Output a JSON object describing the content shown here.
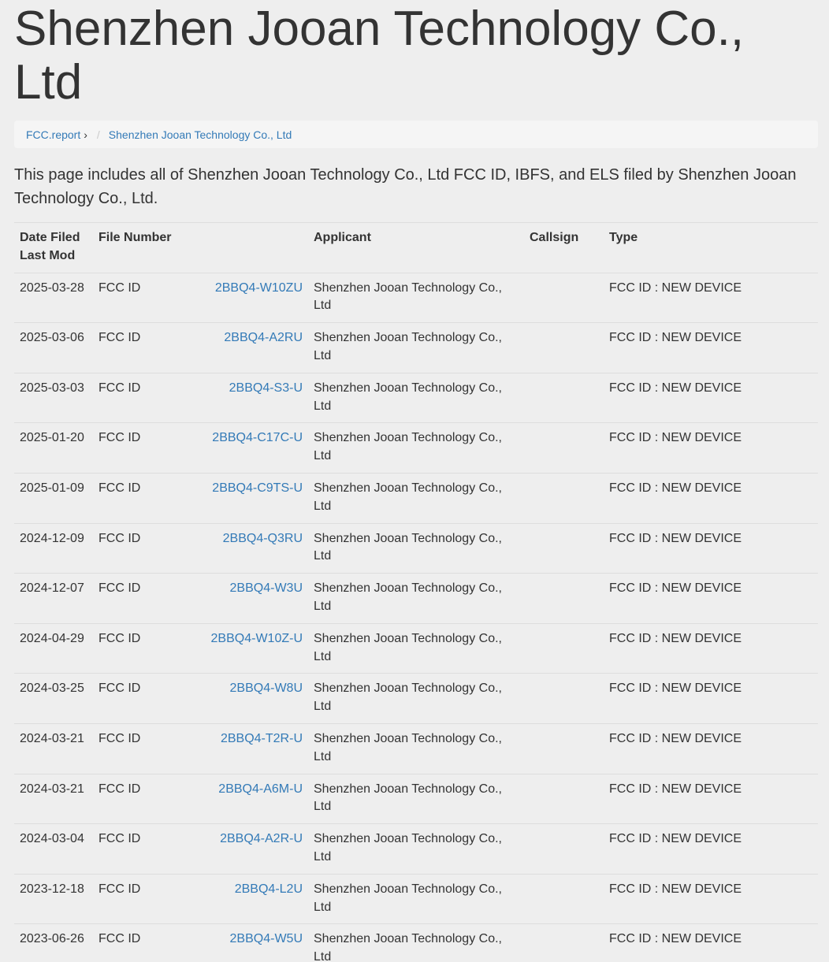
{
  "page_title": "Shenzhen Jooan Technology Co., Ltd",
  "breadcrumb": {
    "home": "FCC.report",
    "home_arrow": "›",
    "separator": "/",
    "current": "Shenzhen Jooan Technology Co., Ltd"
  },
  "intro": "This page includes all of Shenzhen Jooan Technology Co., Ltd FCC ID, IBFS, and ELS filed by Shenzhen Jooan Technology Co., Ltd.",
  "table": {
    "headers": {
      "date_line1": "Date Filed",
      "date_line2": "Last Mod",
      "file_number": "File Number",
      "applicant": "Applicant",
      "callsign": "Callsign",
      "type": "Type"
    },
    "rows": [
      {
        "date": "2025-03-28",
        "kind": "FCC ID",
        "file": "2BBQ4-W10ZU",
        "applicant": "Shenzhen Jooan Technology Co., Ltd",
        "callsign": "",
        "type": "FCC ID : NEW DEVICE"
      },
      {
        "date": "2025-03-06",
        "kind": "FCC ID",
        "file": "2BBQ4-A2RU",
        "applicant": "Shenzhen Jooan Technology Co., Ltd",
        "callsign": "",
        "type": "FCC ID : NEW DEVICE"
      },
      {
        "date": "2025-03-03",
        "kind": "FCC ID",
        "file": "2BBQ4-S3-U",
        "applicant": "Shenzhen Jooan Technology Co., Ltd",
        "callsign": "",
        "type": "FCC ID : NEW DEVICE"
      },
      {
        "date": "2025-01-20",
        "kind": "FCC ID",
        "file": "2BBQ4-C17C-U",
        "applicant": "Shenzhen Jooan Technology Co., Ltd",
        "callsign": "",
        "type": "FCC ID : NEW DEVICE"
      },
      {
        "date": "2025-01-09",
        "kind": "FCC ID",
        "file": "2BBQ4-C9TS-U",
        "applicant": "Shenzhen Jooan Technology Co., Ltd",
        "callsign": "",
        "type": "FCC ID : NEW DEVICE"
      },
      {
        "date": "2024-12-09",
        "kind": "FCC ID",
        "file": "2BBQ4-Q3RU",
        "applicant": "Shenzhen Jooan Technology Co., Ltd",
        "callsign": "",
        "type": "FCC ID : NEW DEVICE"
      },
      {
        "date": "2024-12-07",
        "kind": "FCC ID",
        "file": "2BBQ4-W3U",
        "applicant": "Shenzhen Jooan Technology Co., Ltd",
        "callsign": "",
        "type": "FCC ID : NEW DEVICE"
      },
      {
        "date": "2024-04-29",
        "kind": "FCC ID",
        "file": "2BBQ4-W10Z-U",
        "applicant": "Shenzhen Jooan Technology Co., Ltd",
        "callsign": "",
        "type": "FCC ID : NEW DEVICE"
      },
      {
        "date": "2024-03-25",
        "kind": "FCC ID",
        "file": "2BBQ4-W8U",
        "applicant": "Shenzhen Jooan Technology Co., Ltd",
        "callsign": "",
        "type": "FCC ID : NEW DEVICE"
      },
      {
        "date": "2024-03-21",
        "kind": "FCC ID",
        "file": "2BBQ4-T2R-U",
        "applicant": "Shenzhen Jooan Technology Co., Ltd",
        "callsign": "",
        "type": "FCC ID : NEW DEVICE"
      },
      {
        "date": "2024-03-21",
        "kind": "FCC ID",
        "file": "2BBQ4-A6M-U",
        "applicant": "Shenzhen Jooan Technology Co., Ltd",
        "callsign": "",
        "type": "FCC ID : NEW DEVICE"
      },
      {
        "date": "2024-03-04",
        "kind": "FCC ID",
        "file": "2BBQ4-A2R-U",
        "applicant": "Shenzhen Jooan Technology Co., Ltd",
        "callsign": "",
        "type": "FCC ID : NEW DEVICE"
      },
      {
        "date": "2023-12-18",
        "kind": "FCC ID",
        "file": "2BBQ4-L2U",
        "applicant": "Shenzhen Jooan Technology Co., Ltd",
        "callsign": "",
        "type": "FCC ID : NEW DEVICE"
      },
      {
        "date": "2023-06-26",
        "kind": "FCC ID",
        "file": "2BBQ4-W5U",
        "applicant": "Shenzhen Jooan Technology Co., Ltd",
        "callsign": "",
        "type": "FCC ID : NEW DEVICE"
      }
    ]
  },
  "colors": {
    "link": "#337ab7",
    "text": "#333333",
    "background": "#eeeeee",
    "breadcrumb_bg": "#f5f5f5"
  }
}
